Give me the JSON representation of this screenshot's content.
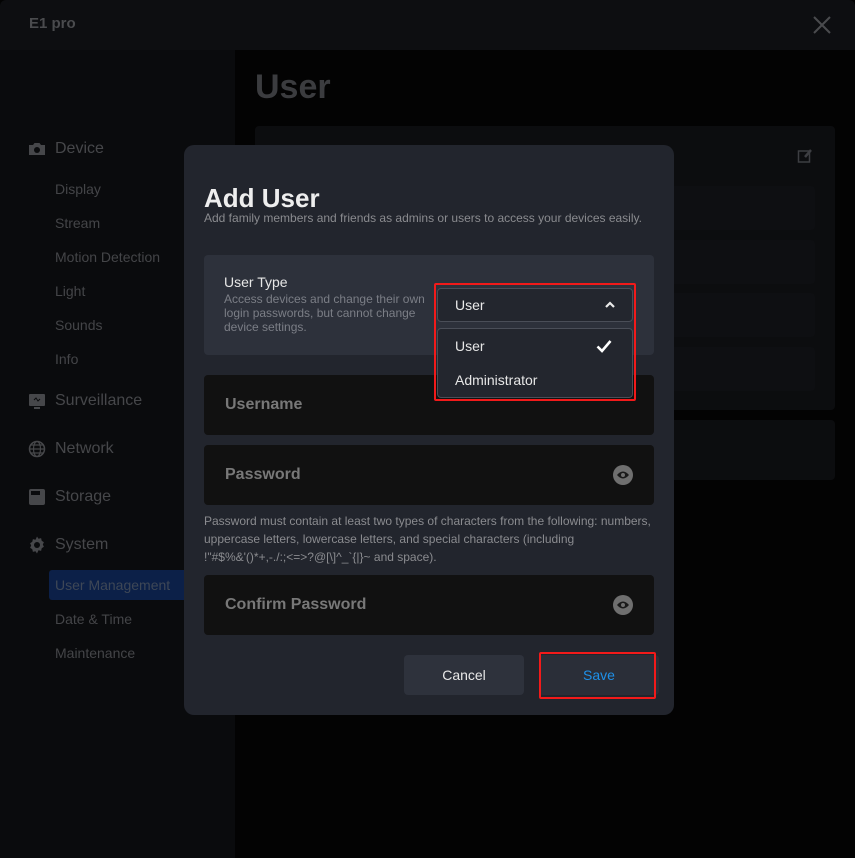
{
  "window": {
    "title": "E1 pro",
    "close_icon": "close-icon"
  },
  "sidebar": {
    "groups": [
      {
        "label": "Device",
        "icon": "camera-icon",
        "items": [
          "Display",
          "Stream",
          "Motion Detection",
          "Light",
          "Sounds",
          "Info"
        ]
      },
      {
        "label": "Surveillance",
        "icon": "monitor-icon",
        "items": []
      },
      {
        "label": "Network",
        "icon": "globe-icon",
        "items": []
      },
      {
        "label": "Storage",
        "icon": "storage-icon",
        "items": []
      },
      {
        "label": "System",
        "icon": "gear-icon",
        "items": [
          "User Management",
          "Date & Time",
          "Maintenance"
        ]
      }
    ],
    "active_item": "User Management"
  },
  "main": {
    "title": "User",
    "edit_icon": "edit-icon"
  },
  "modal": {
    "title": "Add User",
    "subtitle": "Add family members and friends as admins or users to access your devices easily.",
    "user_type": {
      "label": "User Type",
      "description": "Access devices and change their own login passwords, but cannot change device settings.",
      "selected": "User",
      "options": [
        {
          "label": "User",
          "selected": true
        },
        {
          "label": "Administrator",
          "selected": false
        }
      ]
    },
    "username": {
      "placeholder": "Username",
      "value": ""
    },
    "password": {
      "placeholder": "Password",
      "value": ""
    },
    "password_hint": "Password must contain at least two types of characters from the following: numbers, uppercase letters, lowercase letters, and special characters (including !\"#$%&'()*+,-./:;<=>?@[\\]^_`{|}~ and space).",
    "confirm_password": {
      "placeholder": "Confirm Password",
      "value": ""
    },
    "cancel_label": "Cancel",
    "save_label": "Save"
  },
  "colors": {
    "accent": "#1e90e8",
    "annotation": "#f21a1a",
    "active_nav_bg": "#0c2048",
    "modal_bg": "#22252d"
  }
}
